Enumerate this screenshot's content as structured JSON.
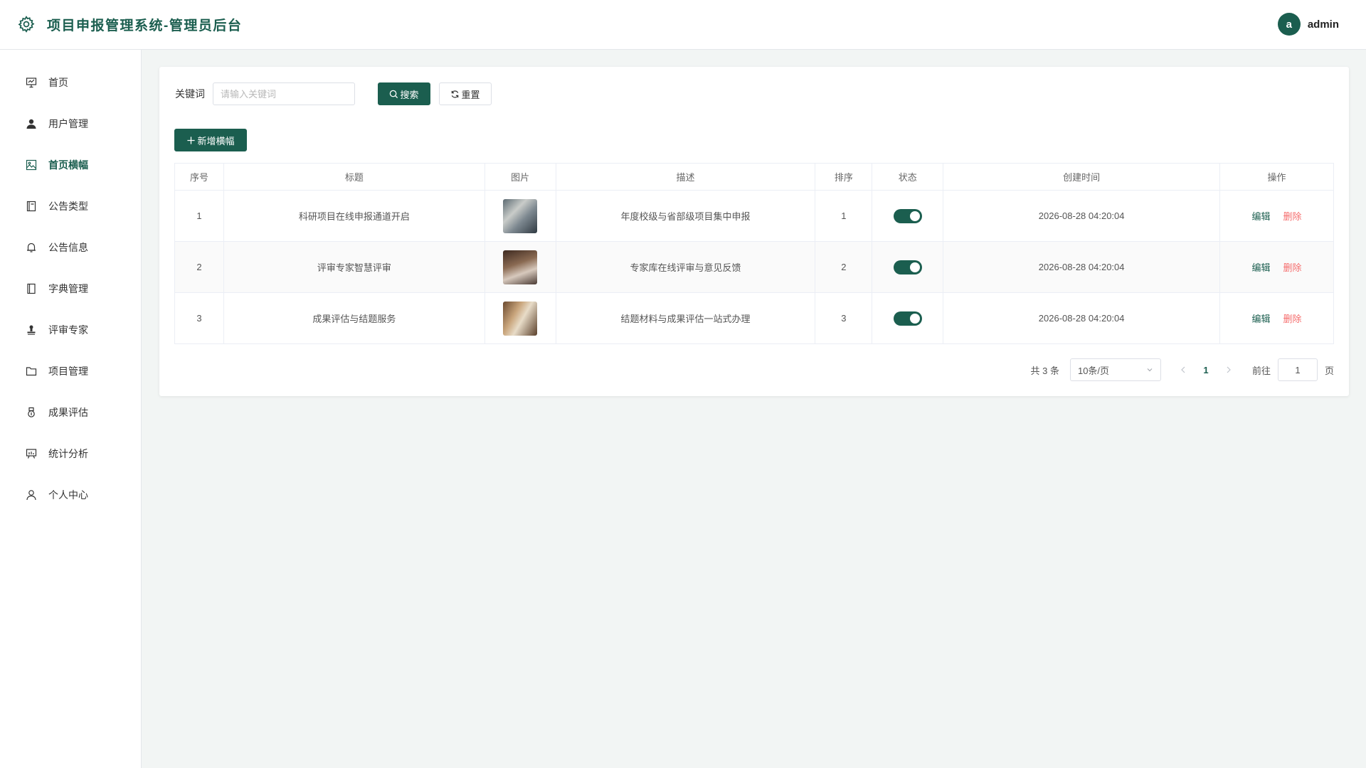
{
  "header": {
    "title": "项目申报管理系统-管理员后台",
    "brand_icon": "gear-icon",
    "avatar_letter": "a",
    "username": "admin"
  },
  "sidebar": {
    "items": [
      {
        "label": "首页",
        "icon": "presentation-chart-icon",
        "active": false
      },
      {
        "label": "用户管理",
        "icon": "user-filled-icon",
        "active": false
      },
      {
        "label": "首页横幅",
        "icon": "picture-icon",
        "active": true
      },
      {
        "label": "公告类型",
        "icon": "notebook-icon",
        "active": false
      },
      {
        "label": "公告信息",
        "icon": "bell-icon",
        "active": false
      },
      {
        "label": "字典管理",
        "icon": "book-icon",
        "active": false
      },
      {
        "label": "评审专家",
        "icon": "stamp-icon",
        "active": false
      },
      {
        "label": "项目管理",
        "icon": "folder-icon",
        "active": false
      },
      {
        "label": "成果评估",
        "icon": "medal-icon",
        "active": false
      },
      {
        "label": "统计分析",
        "icon": "data-board-icon",
        "active": false
      },
      {
        "label": "个人中心",
        "icon": "user-icon",
        "active": false
      }
    ]
  },
  "search": {
    "label": "关键词",
    "placeholder": "请输入关键词",
    "value": "",
    "search_button": "搜索",
    "reset_button": "重置"
  },
  "toolbar": {
    "add_button": "新增横幅"
  },
  "table": {
    "headers": [
      "序号",
      "标题",
      "图片",
      "描述",
      "排序",
      "状态",
      "创建时间",
      "操作"
    ],
    "rows": [
      {
        "index": "1",
        "title": "科研项目在线申报通道开启",
        "description": "年度校级与省部级项目集中申报",
        "sort": "1",
        "status": true,
        "created": "2026-08-28 04:20:04",
        "edit": "编辑",
        "delete": "删除"
      },
      {
        "index": "2",
        "title": "评审专家智慧评审",
        "description": "专家库在线评审与意见反馈",
        "sort": "2",
        "status": true,
        "created": "2026-08-28 04:20:04",
        "edit": "编辑",
        "delete": "删除"
      },
      {
        "index": "3",
        "title": "成果评估与结题服务",
        "description": "结题材料与成果评估一站式办理",
        "sort": "3",
        "status": true,
        "created": "2026-08-28 04:20:04",
        "edit": "编辑",
        "delete": "删除"
      }
    ]
  },
  "pagination": {
    "total_text": "共 3 条",
    "page_size": "10条/页",
    "current_page": "1",
    "goto_label": "前往",
    "goto_value": "1",
    "goto_suffix": "页"
  },
  "colors": {
    "primary": "#1b5e4f",
    "danger": "#f56c6c",
    "background": "#f2f5f4"
  }
}
